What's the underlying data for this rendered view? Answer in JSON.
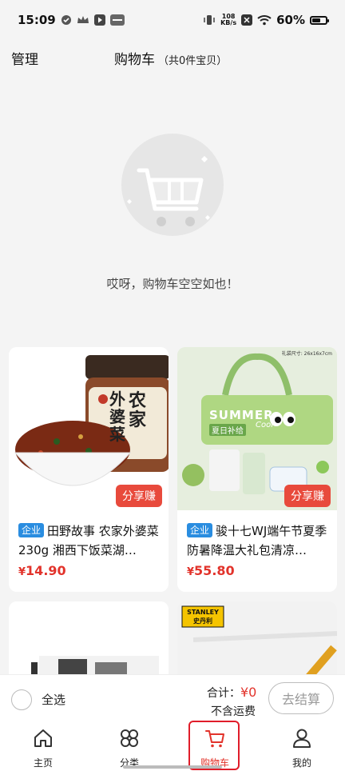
{
  "status_bar": {
    "time": "15:09",
    "left_icons": [
      "check-circle-icon",
      "crown-icon",
      "play-badge-icon",
      "app-badge-icon"
    ],
    "net_speed_value": "108",
    "net_speed_unit": "KB/s",
    "battery": "60%",
    "battery_level": 0.6
  },
  "header": {
    "manage_label": "管理",
    "title": "购物车",
    "count_label": "（共0件宝贝）"
  },
  "empty_state": {
    "illustration_icon": "empty-cart-icon",
    "message": "哎呀，购物车空空如也！"
  },
  "products": [
    {
      "tag": "企业",
      "title": "田野故事 农家外婆菜230g 湘西下饭菜湖…",
      "price_symbol": "¥",
      "price": "14.90",
      "share_label": "分享赚",
      "jar_label_line1": "农家",
      "jar_label_line2": "外婆菜"
    },
    {
      "tag": "企业",
      "title": "骏十七WJ端午节夏季防暑降温大礼包清凉…",
      "price_symbol": "¥",
      "price": "55.80",
      "share_label": "分享赚",
      "size_note": "礼袋尺寸: 26x16x7cm",
      "bag_text": "SUMMER",
      "bag_subtext": "夏日补给",
      "bag_script": "Cool"
    },
    {
      "tag": "",
      "title": "",
      "price": ""
    },
    {
      "tag": "",
      "title": "",
      "price": "",
      "brand_line1": "STANLEY",
      "brand_line2": "史丹利"
    }
  ],
  "checkout": {
    "select_all_label": "全选",
    "total_label": "合计：",
    "total_amount": "¥0",
    "shipping_note": "不含运费",
    "checkout_button": "去结算"
  },
  "tabs": [
    {
      "label": "主页",
      "icon": "home-icon",
      "active": false
    },
    {
      "label": "分类",
      "icon": "category-icon",
      "active": false
    },
    {
      "label": "购物车",
      "icon": "cart-icon",
      "active": true
    },
    {
      "label": "我的",
      "icon": "profile-icon",
      "active": false
    }
  ],
  "colors": {
    "accent_red": "#e2332b",
    "tag_blue": "#2a8de0",
    "background": "#f4f4f4"
  }
}
